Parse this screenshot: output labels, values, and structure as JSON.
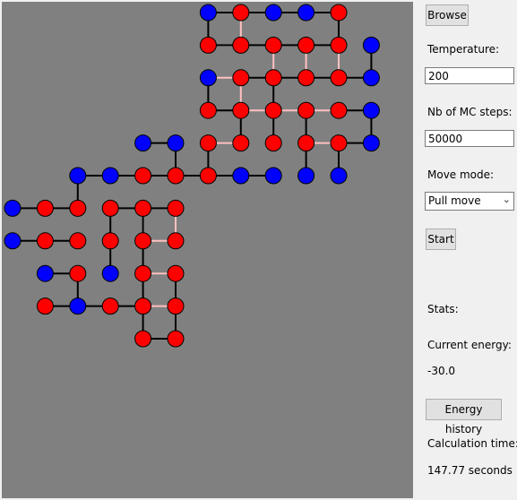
{
  "colors": {
    "canvas_bg": "#808080",
    "hydrophobic": "#ff0000",
    "polar": "#0000ff",
    "bond": "#000000",
    "contact": "#ffc0c0",
    "outline": "#000000"
  },
  "controls": {
    "browse_label": "Browse",
    "temperature_label": "Temperature:",
    "temperature_value": "200",
    "steps_label": "Nb of MC steps:",
    "steps_value": "50000",
    "move_mode_label": "Move mode:",
    "move_mode_value": "Pull move",
    "start_label": "Start",
    "stats_label": "Stats:",
    "energy_label": "Current energy:",
    "energy_value": "-30.0",
    "energy_history_label": "Energy history",
    "calc_time_label": "Calculation time:",
    "calc_time_value": "147.77 seconds"
  },
  "lattice": {
    "residues": [
      {
        "c": 6,
        "r": 0,
        "t": "P"
      },
      {
        "c": 7,
        "r": 0,
        "t": "H"
      },
      {
        "c": 8,
        "r": 0,
        "t": "P"
      },
      {
        "c": 9,
        "r": 0,
        "t": "P"
      },
      {
        "c": 10,
        "r": 0,
        "t": "H"
      },
      {
        "c": 6,
        "r": 1,
        "t": "H"
      },
      {
        "c": 7,
        "r": 1,
        "t": "H"
      },
      {
        "c": 8,
        "r": 1,
        "t": "H"
      },
      {
        "c": 9,
        "r": 1,
        "t": "H"
      },
      {
        "c": 10,
        "r": 1,
        "t": "H"
      },
      {
        "c": 11,
        "r": 1,
        "t": "P"
      },
      {
        "c": 6,
        "r": 2,
        "t": "P"
      },
      {
        "c": 7,
        "r": 2,
        "t": "H"
      },
      {
        "c": 8,
        "r": 2,
        "t": "H"
      },
      {
        "c": 9,
        "r": 2,
        "t": "H"
      },
      {
        "c": 10,
        "r": 2,
        "t": "H"
      },
      {
        "c": 11,
        "r": 2,
        "t": "P"
      },
      {
        "c": 6,
        "r": 3,
        "t": "H"
      },
      {
        "c": 7,
        "r": 3,
        "t": "H"
      },
      {
        "c": 8,
        "r": 3,
        "t": "H"
      },
      {
        "c": 9,
        "r": 3,
        "t": "H"
      },
      {
        "c": 10,
        "r": 3,
        "t": "H"
      },
      {
        "c": 11,
        "r": 3,
        "t": "P"
      },
      {
        "c": 4,
        "r": 4,
        "t": "P"
      },
      {
        "c": 5,
        "r": 4,
        "t": "P"
      },
      {
        "c": 6,
        "r": 4,
        "t": "H"
      },
      {
        "c": 7,
        "r": 4,
        "t": "H"
      },
      {
        "c": 8,
        "r": 4,
        "t": "H"
      },
      {
        "c": 9,
        "r": 4,
        "t": "H"
      },
      {
        "c": 10,
        "r": 4,
        "t": "H"
      },
      {
        "c": 11,
        "r": 4,
        "t": "P"
      },
      {
        "c": 2,
        "r": 5,
        "t": "P"
      },
      {
        "c": 3,
        "r": 5,
        "t": "P"
      },
      {
        "c": 4,
        "r": 5,
        "t": "H"
      },
      {
        "c": 5,
        "r": 5,
        "t": "H"
      },
      {
        "c": 6,
        "r": 5,
        "t": "H"
      },
      {
        "c": 7,
        "r": 5,
        "t": "P"
      },
      {
        "c": 8,
        "r": 5,
        "t": "P"
      },
      {
        "c": 9,
        "r": 5,
        "t": "P"
      },
      {
        "c": 10,
        "r": 5,
        "t": "P"
      },
      {
        "c": 0,
        "r": 6,
        "t": "P"
      },
      {
        "c": 1,
        "r": 6,
        "t": "H"
      },
      {
        "c": 2,
        "r": 6,
        "t": "H"
      },
      {
        "c": 3,
        "r": 6,
        "t": "H"
      },
      {
        "c": 4,
        "r": 6,
        "t": "H"
      },
      {
        "c": 5,
        "r": 6,
        "t": "H"
      },
      {
        "c": 0,
        "r": 7,
        "t": "P"
      },
      {
        "c": 1,
        "r": 7,
        "t": "H"
      },
      {
        "c": 2,
        "r": 7,
        "t": "H"
      },
      {
        "c": 3,
        "r": 7,
        "t": "H"
      },
      {
        "c": 4,
        "r": 7,
        "t": "H"
      },
      {
        "c": 5,
        "r": 7,
        "t": "H"
      },
      {
        "c": 1,
        "r": 8,
        "t": "P"
      },
      {
        "c": 2,
        "r": 8,
        "t": "H"
      },
      {
        "c": 3,
        "r": 8,
        "t": "P"
      },
      {
        "c": 4,
        "r": 8,
        "t": "H"
      },
      {
        "c": 5,
        "r": 8,
        "t": "H"
      },
      {
        "c": 1,
        "r": 9,
        "t": "H"
      },
      {
        "c": 2,
        "r": 9,
        "t": "P"
      },
      {
        "c": 3,
        "r": 9,
        "t": "H"
      },
      {
        "c": 4,
        "r": 9,
        "t": "H"
      },
      {
        "c": 5,
        "r": 9,
        "t": "H"
      },
      {
        "c": 4,
        "r": 10,
        "t": "H"
      },
      {
        "c": 5,
        "r": 10,
        "t": "H"
      }
    ],
    "bonds": [
      [
        6,
        0,
        7,
        0
      ],
      [
        7,
        0,
        8,
        0
      ],
      [
        8,
        0,
        9,
        0
      ],
      [
        9,
        0,
        10,
        0
      ],
      [
        10,
        0,
        10,
        1
      ],
      [
        10,
        1,
        9,
        1
      ],
      [
        9,
        1,
        8,
        1
      ],
      [
        8,
        1,
        7,
        1
      ],
      [
        7,
        1,
        6,
        1
      ],
      [
        11,
        1,
        11,
        2
      ],
      [
        11,
        2,
        10,
        2
      ],
      [
        10,
        2,
        9,
        2
      ],
      [
        9,
        2,
        8,
        2
      ],
      [
        8,
        2,
        7,
        2
      ],
      [
        6,
        2,
        6,
        3
      ],
      [
        6,
        3,
        7,
        3
      ],
      [
        7,
        3,
        7,
        4
      ],
      [
        8,
        2,
        8,
        3
      ],
      [
        8,
        3,
        8,
        4
      ],
      [
        9,
        3,
        9,
        4
      ],
      [
        10,
        3,
        11,
        3
      ],
      [
        11,
        3,
        11,
        4
      ],
      [
        11,
        4,
        10,
        4
      ],
      [
        10,
        4,
        10,
        5
      ],
      [
        9,
        4,
        9,
        5
      ],
      [
        4,
        4,
        5,
        4
      ],
      [
        5,
        4,
        5,
        5
      ],
      [
        6,
        4,
        6,
        5
      ],
      [
        2,
        5,
        3,
        5
      ],
      [
        3,
        5,
        4,
        5
      ],
      [
        4,
        5,
        5,
        5
      ],
      [
        5,
        5,
        6,
        5
      ],
      [
        6,
        5,
        7,
        5
      ],
      [
        7,
        5,
        8,
        5
      ],
      [
        0,
        6,
        1,
        6
      ],
      [
        1,
        6,
        2,
        6
      ],
      [
        2,
        6,
        2,
        5
      ],
      [
        3,
        6,
        4,
        6
      ],
      [
        4,
        6,
        5,
        6
      ],
      [
        3,
        6,
        3,
        7
      ],
      [
        3,
        7,
        3,
        8
      ],
      [
        2,
        7,
        1,
        7
      ],
      [
        0,
        7,
        1,
        7
      ],
      [
        4,
        6,
        4,
        7
      ],
      [
        4,
        7,
        4,
        8
      ],
      [
        4,
        8,
        4,
        9
      ],
      [
        3,
        9,
        4,
        9
      ],
      [
        2,
        9,
        3,
        9
      ],
      [
        1,
        9,
        2,
        9
      ],
      [
        2,
        8,
        1,
        8
      ],
      [
        2,
        8,
        2,
        9
      ],
      [
        5,
        8,
        5,
        9
      ],
      [
        5,
        9,
        5,
        10
      ],
      [
        5,
        10,
        4,
        10
      ],
      [
        4,
        10,
        4,
        9
      ],
      [
        6,
        0,
        6,
        1
      ]
    ],
    "contacts": [
      [
        7,
        0,
        7,
        1
      ],
      [
        8,
        1,
        8,
        2
      ],
      [
        9,
        1,
        9,
        2
      ],
      [
        10,
        1,
        10,
        2
      ],
      [
        7,
        2,
        7,
        3
      ],
      [
        9,
        3,
        10,
        3
      ],
      [
        9,
        4,
        10,
        4
      ],
      [
        6,
        4,
        7,
        4
      ],
      [
        7,
        3,
        8,
        3
      ],
      [
        8,
        3,
        9,
        3
      ],
      [
        6,
        1,
        7,
        1
      ],
      [
        4,
        7,
        5,
        7
      ],
      [
        4,
        8,
        5,
        8
      ],
      [
        4,
        9,
        5,
        9
      ],
      [
        4,
        6,
        4,
        7
      ],
      [
        5,
        6,
        5,
        7
      ],
      [
        6,
        2,
        7,
        2
      ]
    ]
  }
}
